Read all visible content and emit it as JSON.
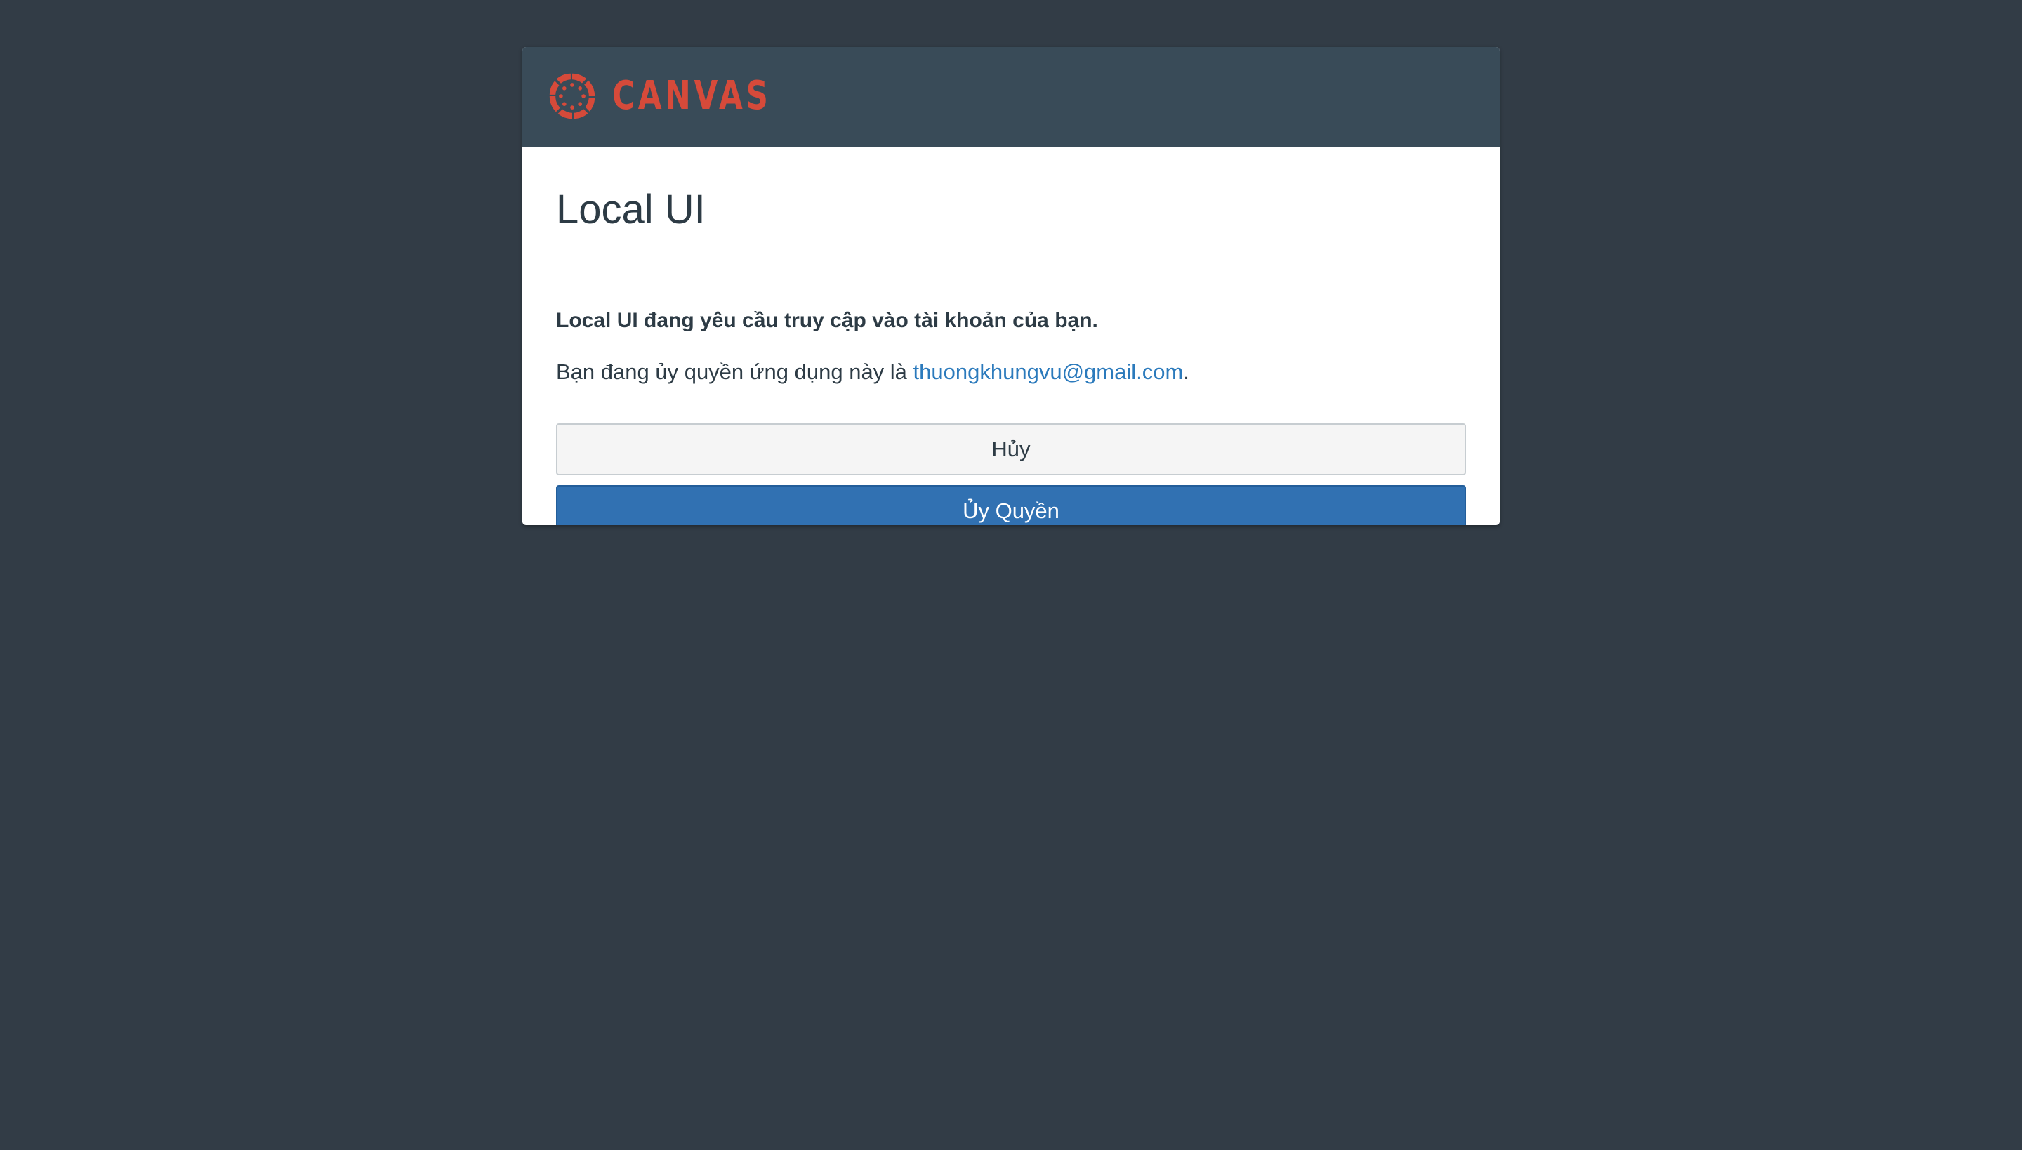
{
  "brand": {
    "logo_icon": "canvas-logo-icon",
    "wordmark": "CANVAS",
    "color": "#d64a3a"
  },
  "dialog": {
    "title": "Local UI",
    "request_text": "Local UI đang yêu cầu truy cập vào tài khoản của bạn.",
    "auth_prefix": "Bạn đang ủy quyền ứng dụng này là ",
    "auth_email": "thuongkhungvu@gmail.com",
    "auth_suffix": "."
  },
  "buttons": {
    "cancel_label": "Hủy",
    "authorize_label": "Ủy Quyền"
  },
  "colors": {
    "page_background": "#323c46",
    "header_background": "#394b58",
    "link": "#2b7abc",
    "primary_button": "#3171b2",
    "text": "#2d3b45"
  }
}
